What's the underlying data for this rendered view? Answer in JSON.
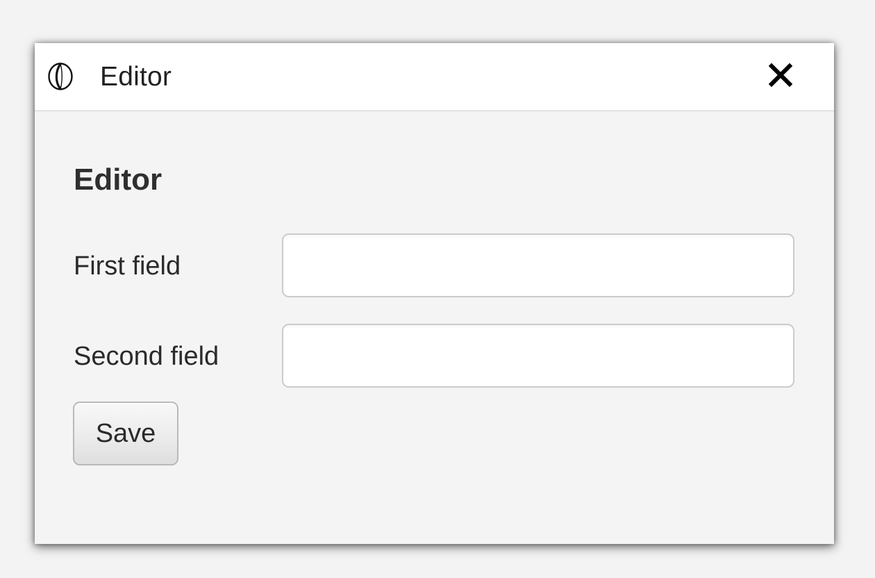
{
  "window": {
    "title": "Editor",
    "app_icon": "app-logo-icon",
    "close_icon": "close-icon"
  },
  "form": {
    "heading": "Editor",
    "fields": [
      {
        "label": "First field",
        "value": "",
        "placeholder": ""
      },
      {
        "label": "Second field",
        "value": "",
        "placeholder": ""
      }
    ],
    "save_label": "Save"
  },
  "colors": {
    "background": "#f3f3f3",
    "titlebar": "#ffffff",
    "content": "#f4f4f4",
    "text": "#2a2a2a"
  }
}
